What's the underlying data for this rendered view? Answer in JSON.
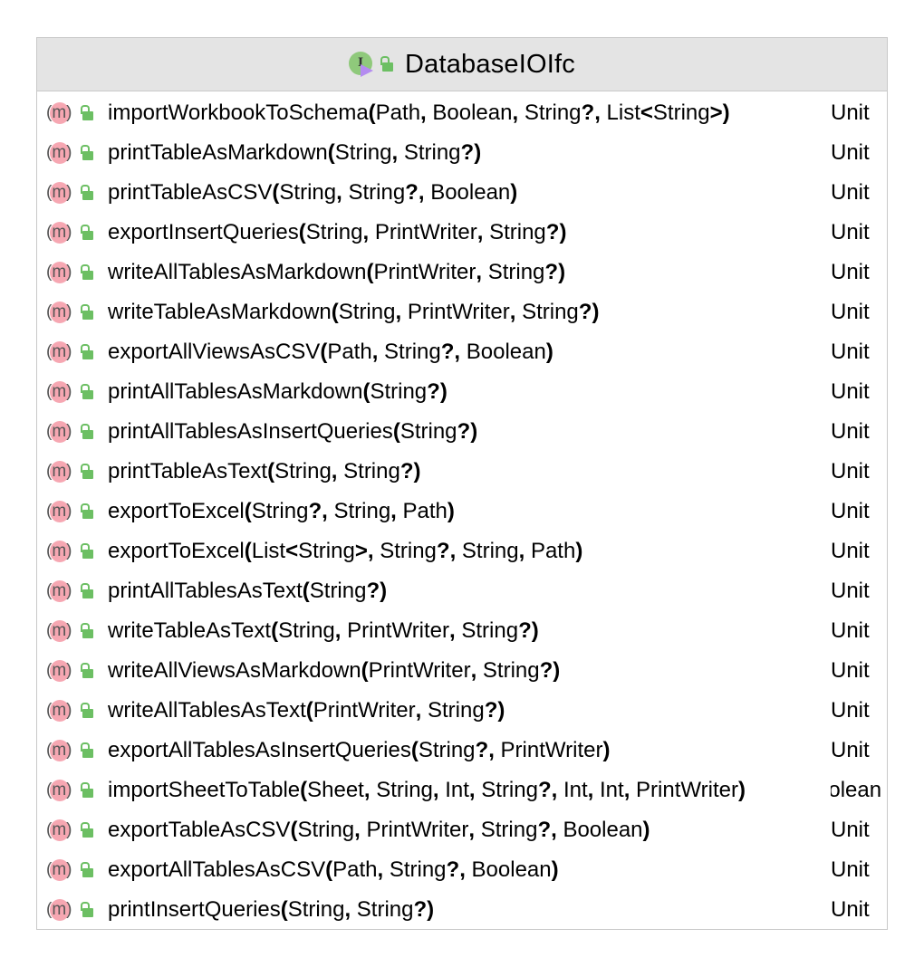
{
  "class": {
    "name": "DatabaseIOIfc",
    "icon": "interface-kotlin-icon",
    "visibility_icon": "public-lock-icon"
  },
  "methods": [
    {
      "name": "importWorkbookToSchema",
      "params": [
        "Path",
        "Boolean",
        "String?",
        "List<String>"
      ],
      "return": "Unit"
    },
    {
      "name": "printTableAsMarkdown",
      "params": [
        "String",
        "String?"
      ],
      "return": "Unit"
    },
    {
      "name": "printTableAsCSV",
      "params": [
        "String",
        "String?",
        "Boolean"
      ],
      "return": "Unit"
    },
    {
      "name": "exportInsertQueries",
      "params": [
        "String",
        "PrintWriter",
        "String?"
      ],
      "return": "Unit"
    },
    {
      "name": "writeAllTablesAsMarkdown",
      "params": [
        "PrintWriter",
        "String?"
      ],
      "return": "Unit"
    },
    {
      "name": "writeTableAsMarkdown",
      "params": [
        "String",
        "PrintWriter",
        "String?"
      ],
      "return": "Unit"
    },
    {
      "name": "exportAllViewsAsCSV",
      "params": [
        "Path",
        "String?",
        "Boolean"
      ],
      "return": "Unit"
    },
    {
      "name": "printAllTablesAsMarkdown",
      "params": [
        "String?"
      ],
      "return": "Unit"
    },
    {
      "name": "printAllTablesAsInsertQueries",
      "params": [
        "String?"
      ],
      "return": "Unit"
    },
    {
      "name": "printTableAsText",
      "params": [
        "String",
        "String?"
      ],
      "return": "Unit"
    },
    {
      "name": "exportToExcel",
      "params": [
        "String?",
        "String",
        "Path"
      ],
      "return": "Unit"
    },
    {
      "name": "exportToExcel",
      "params": [
        "List<String>",
        "String?",
        "String",
        "Path"
      ],
      "return": "Unit"
    },
    {
      "name": "printAllTablesAsText",
      "params": [
        "String?"
      ],
      "return": "Unit"
    },
    {
      "name": "writeTableAsText",
      "params": [
        "String",
        "PrintWriter",
        "String?"
      ],
      "return": "Unit"
    },
    {
      "name": "writeAllViewsAsMarkdown",
      "params": [
        "PrintWriter",
        "String?"
      ],
      "return": "Unit"
    },
    {
      "name": "writeAllTablesAsText",
      "params": [
        "PrintWriter",
        "String?"
      ],
      "return": "Unit"
    },
    {
      "name": "exportAllTablesAsInsertQueries",
      "params": [
        "String?",
        "PrintWriter"
      ],
      "return": "Unit"
    },
    {
      "name": "importSheetToTable",
      "params": [
        "Sheet",
        "String",
        "Int",
        "String?",
        "Int",
        "Int",
        "PrintWriter"
      ],
      "return": "Boolean",
      "return_clipped": true
    },
    {
      "name": "exportTableAsCSV",
      "params": [
        "String",
        "PrintWriter",
        "String?",
        "Boolean"
      ],
      "return": "Unit"
    },
    {
      "name": "exportAllTablesAsCSV",
      "params": [
        "Path",
        "String?",
        "Boolean"
      ],
      "return": "Unit"
    },
    {
      "name": "printInsertQueries",
      "params": [
        "String",
        "String?"
      ],
      "return": "Unit"
    }
  ],
  "method_icon_letter": "m"
}
